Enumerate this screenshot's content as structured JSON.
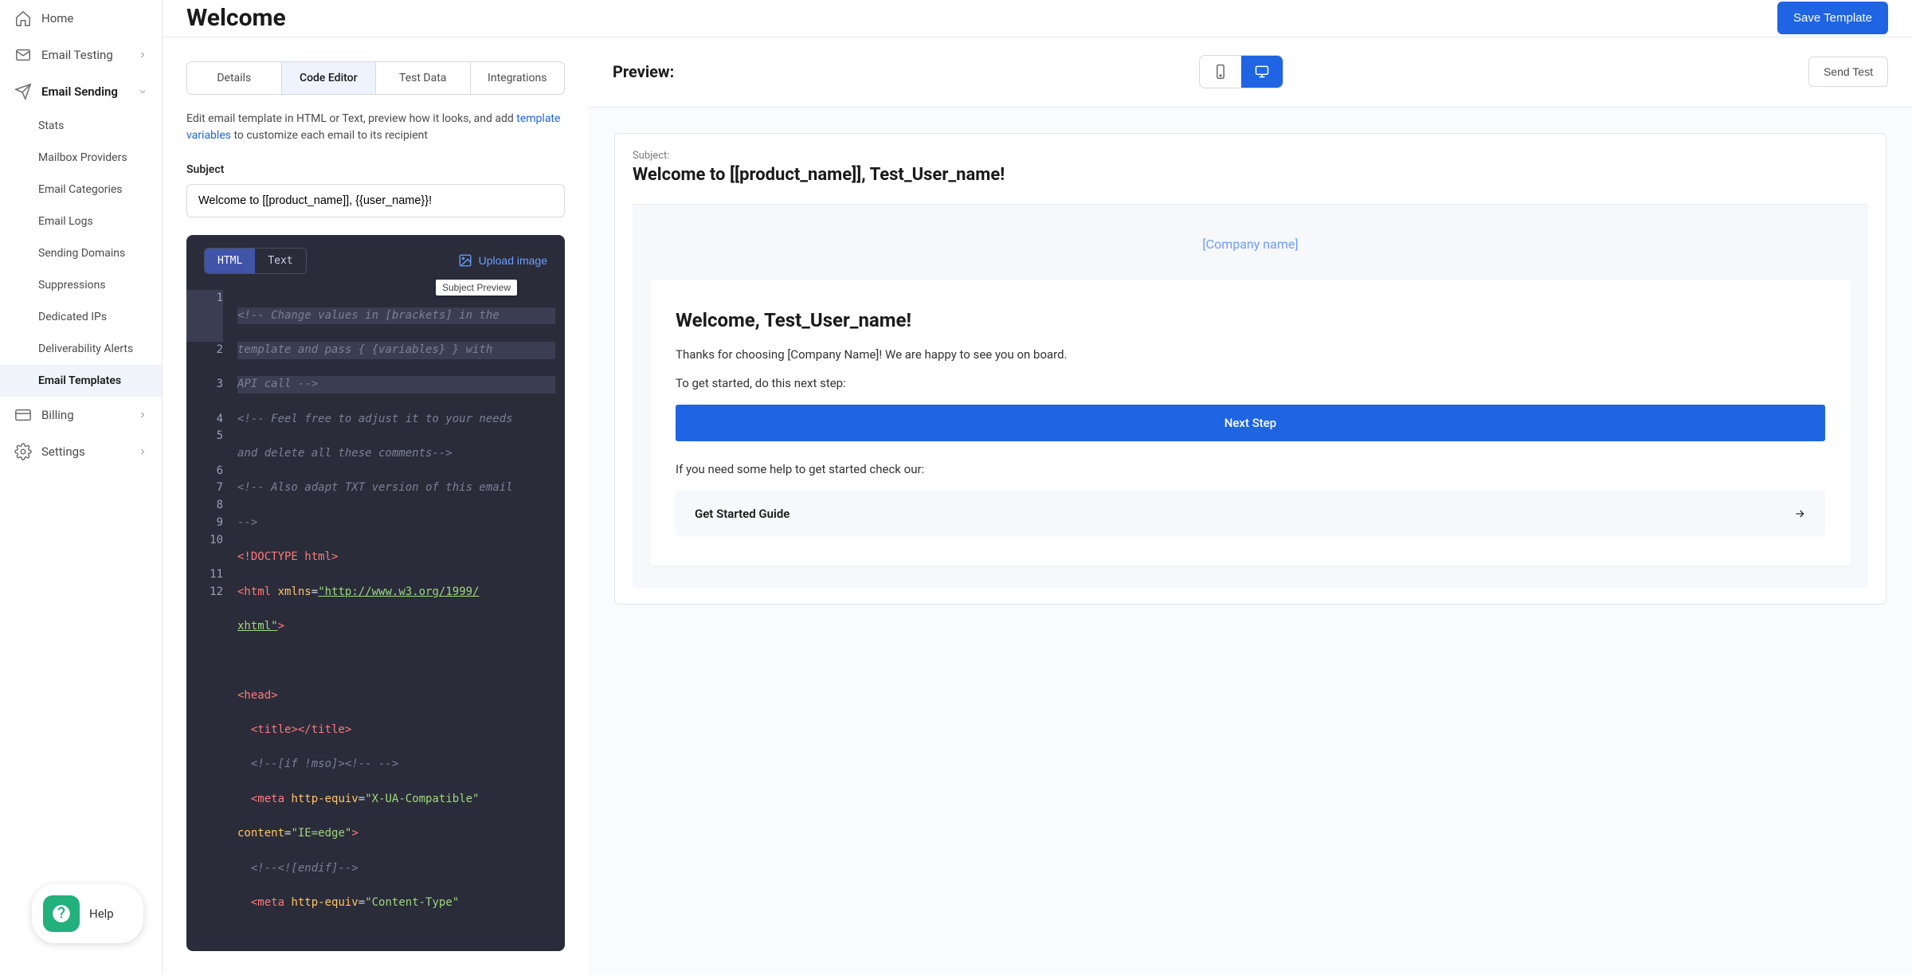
{
  "header": {
    "title": "Welcome",
    "save_label": "Save Template"
  },
  "sidebar": {
    "help_label": "Help",
    "items": [
      {
        "label": "Home"
      },
      {
        "label": "Email Testing"
      },
      {
        "label": "Email Sending"
      },
      {
        "label": "Stats"
      },
      {
        "label": "Mailbox Providers"
      },
      {
        "label": "Email Categories"
      },
      {
        "label": "Email Logs"
      },
      {
        "label": "Sending Domains"
      },
      {
        "label": "Suppressions"
      },
      {
        "label": "Dedicated IPs"
      },
      {
        "label": "Deliverability Alerts"
      },
      {
        "label": "Email Templates"
      },
      {
        "label": "Billing"
      },
      {
        "label": "Settings"
      }
    ]
  },
  "tabs": {
    "details": "Details",
    "code": "Code Editor",
    "test": "Test Data",
    "integrations": "Integrations"
  },
  "helper": {
    "line1a": "Edit email template in HTML or Text, preview how it looks, and add ",
    "link": "template variables",
    "line1b": " to customize each email to its recipient"
  },
  "subject": {
    "label": "Subject",
    "value": "Welcome to [[product_name]], {{user_name}}!"
  },
  "editor": {
    "html_tab": "HTML",
    "text_tab": "Text",
    "upload": "Upload image",
    "tooltip": "Subject Preview",
    "gutter": [
      "1",
      "2",
      "3",
      "4",
      "5",
      "6",
      "7",
      "8",
      "9",
      "10",
      "11",
      "12"
    ]
  },
  "preview": {
    "label": "Preview:",
    "send_test": "Send Test",
    "subject_label": "Subject:",
    "subject_value": "Welcome to [[product_name]], Test_User_name!",
    "company": "[Company name]",
    "h1": "Welcome, Test_User_name!",
    "p1": "Thanks for choosing [Company Name]! We are happy to see you on board.",
    "p2": "To get started, do this next step:",
    "cta": "Next Step",
    "p3": "If you need some help to get started check our:",
    "guide": "Get Started Guide"
  }
}
